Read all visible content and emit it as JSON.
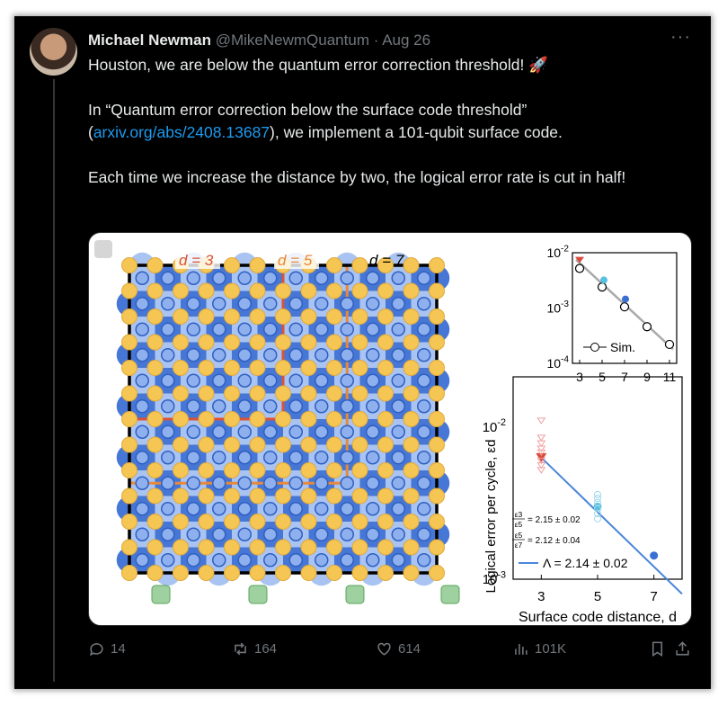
{
  "author": {
    "name": "Michael Newman",
    "handle": "@MikeNewmQuantum",
    "date": "Aug 26"
  },
  "tweet": {
    "line1": "Houston, we are below the quantum error correction threshold! 🚀",
    "line2_pre": "In “Quantum error correction below the surface code threshold” (",
    "link": "arxiv.org/abs/2408.13687",
    "line2_post": "), we implement a 101-qubit surface code.",
    "line3": "Each time we increase the distance by two, the logical error rate is cut in half!"
  },
  "figure": {
    "labels": {
      "d3": "d = 3",
      "d5": "d = 5",
      "d7": "d = 7"
    },
    "colors": {
      "d3": "#d9533a",
      "d5": "#e8893a",
      "d7": "#000000",
      "data_qubit": "#f5c653",
      "measure_qubit": "#5b8fe0",
      "light_tile": "#a9c4f2",
      "dark_tile": "#4677d6"
    }
  },
  "chart_data": {
    "type": "scatter",
    "title": "",
    "xlabel": "Surface code distance, d",
    "ylabel": "Logical error per cycle, εd",
    "x_ticks": [
      "3",
      "5",
      "7"
    ],
    "y_ticks": [
      "10^-2",
      "10^-3"
    ],
    "y_scale": "log",
    "ylim": [
      0.001,
      0.02
    ],
    "xlim": [
      2,
      8
    ],
    "series": [
      {
        "x": [
          3,
          5,
          7
        ],
        "y": [
          0.0063,
          0.003,
          0.00143
        ]
      }
    ],
    "fit_line": {
      "x": [
        3,
        8
      ],
      "y": [
        0.0063,
        0.0008
      ]
    },
    "annotations": {
      "ratio1_frac_top": "ε3",
      "ratio1_frac_bot": "ε5",
      "ratio1": "= 2.15 ± 0.02",
      "ratio2_frac_top": "ε5",
      "ratio2_frac_bot": "ε7",
      "ratio2": "= 2.12 ± 0.04",
      "lambda": "Λ = 2.14 ± 0.02"
    },
    "inset": {
      "type": "scatter",
      "x_ticks": [
        "3",
        "5",
        "7",
        "9",
        "11"
      ],
      "y_ticks": [
        "10^-2",
        "10^-3",
        "10^-4"
      ],
      "y_scale": "log",
      "ylim": [
        0.0001,
        0.01
      ],
      "legend": "Sim.",
      "series": [
        {
          "x": [
            3,
            5,
            7,
            9,
            11
          ],
          "y": [
            0.0052,
            0.0024,
            0.00105,
            0.00046,
            0.00022
          ]
        }
      ]
    }
  },
  "actions": {
    "replies": "14",
    "reposts": "164",
    "likes": "614",
    "views": "101K"
  }
}
